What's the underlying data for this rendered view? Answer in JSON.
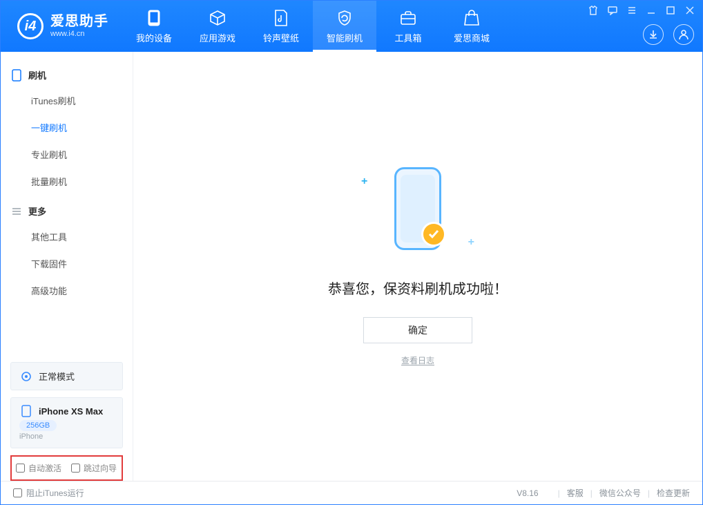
{
  "brand": {
    "name": "爱思助手",
    "site": "www.i4.cn"
  },
  "nav": {
    "device": "我的设备",
    "apps": "应用游戏",
    "ringtones": "铃声壁纸",
    "flash": "智能刷机",
    "toolbox": "工具箱",
    "store": "爱思商城"
  },
  "sidebar": {
    "flash_section": "刷机",
    "itunes_flash": "iTunes刷机",
    "one_click_flash": "一键刷机",
    "pro_flash": "专业刷机",
    "batch_flash": "批量刷机",
    "more_section": "更多",
    "other_tools": "其他工具",
    "download_firmware": "下载固件",
    "advanced": "高级功能"
  },
  "mode": {
    "label": "正常模式"
  },
  "device": {
    "name": "iPhone XS Max",
    "storage": "256GB",
    "type": "iPhone"
  },
  "checks": {
    "auto_activate": "自动激活",
    "skip_guide": "跳过向导"
  },
  "main": {
    "title": "恭喜您，保资料刷机成功啦！",
    "ok": "确定",
    "view_log": "查看日志"
  },
  "status": {
    "block_itunes": "阻止iTunes运行",
    "version": "V8.16",
    "service": "客服",
    "wechat": "微信公众号",
    "check_update": "检查更新"
  }
}
